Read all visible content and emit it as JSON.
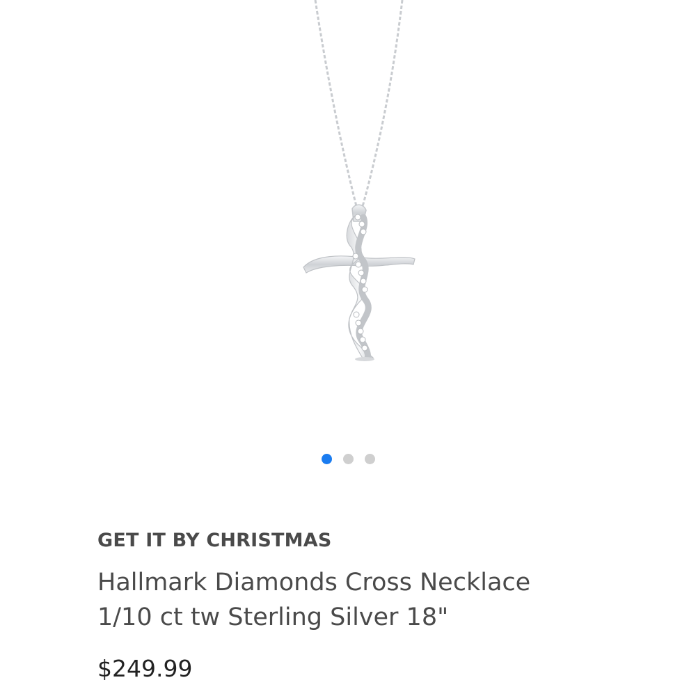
{
  "gallery": {
    "image_alt": "Cross pendant on chain",
    "image_count": 3,
    "active_index": 0,
    "colors": {
      "active_dot": "#1a7cf0",
      "inactive_dot": "#cfcfcf",
      "metal": "#d6d8db"
    }
  },
  "product": {
    "promo": "GET IT BY CHRISTMAS",
    "title": "Hallmark Diamonds Cross Necklace 1/10 ct tw Sterling Silver 18\"",
    "price": "$249.99"
  }
}
